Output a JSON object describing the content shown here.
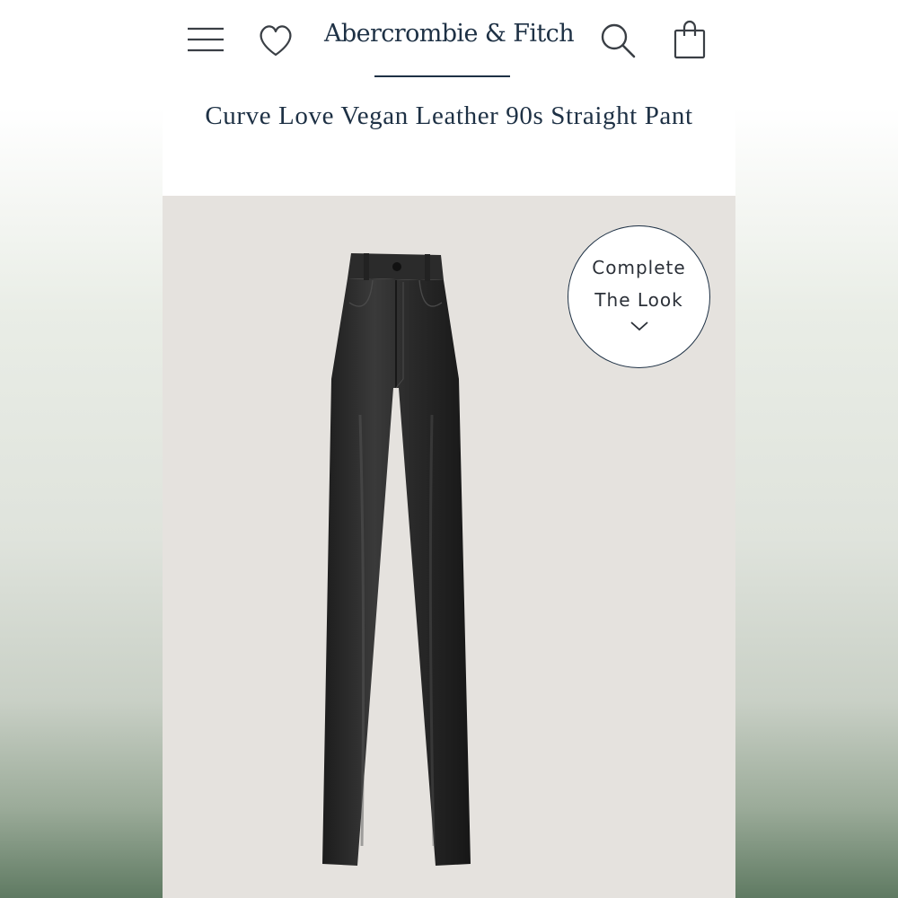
{
  "header": {
    "brand": "Abercrombie & Fitch",
    "icons": {
      "menu": "menu-icon",
      "wishlist": "heart-icon",
      "search": "search-icon",
      "bag": "shopping-bag-icon"
    }
  },
  "product": {
    "title": "Curve Love Vegan Leather 90s Straight Pant",
    "image": "black-vegan-leather-straight-pants"
  },
  "complete_look": {
    "line1": "Complete",
    "line2": "The Look",
    "icon": "chevron-down-icon"
  },
  "colors": {
    "brand_navy": "#1e3145",
    "product_background": "#e5e2de",
    "pants": "#2a2a2a"
  }
}
